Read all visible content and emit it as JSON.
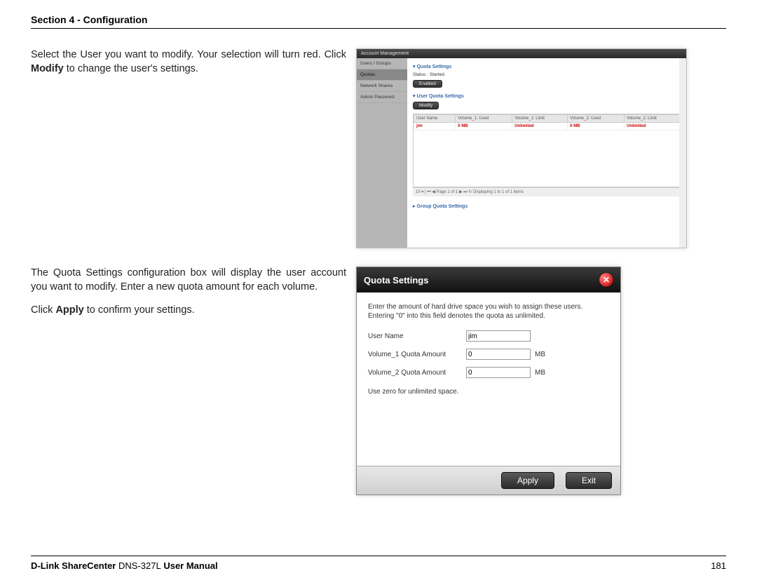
{
  "header": {
    "section": "Section 4 - Configuration"
  },
  "block1": {
    "p1a": "Select the User you want to modify. Your selection will turn red. Click ",
    "p1bold": "Modify",
    "p1b": " to change the user's settings."
  },
  "shot1": {
    "title": "Account Management",
    "sidebar": [
      "Users / Groups",
      "Quotas",
      "Network Shares",
      "Admin Password"
    ],
    "panel_quota": "Quota Settings",
    "status_label": "Status :",
    "status_value": "Started",
    "btn_enabled": "Enabled",
    "panel_user_quota": "User Quota Settings",
    "btn_modify": "Modify",
    "cols": [
      "User Name",
      "Volume_1: Used",
      "Volume_1: Limit",
      "Volume_2: Used",
      "Volume_2: Limit"
    ],
    "row": {
      "user": "jim",
      "v1u": "0 MB",
      "v1l": "Unlimited",
      "v2u": "0 MB",
      "v2l": "Unlimited"
    },
    "pager": "10 ▾ | ⏮ ◀  Page 1   of 1  ▶ ⏭  ↻   Displaying 1 to 1 of 1 items",
    "panel_group_quota": "Group Quota Settings"
  },
  "block2": {
    "p1": "The Quota Settings configuration box will display the user account you want to modify. Enter a new quota amount for each volume.",
    "p2a": "Click ",
    "p2bold": "Apply",
    "p2b": " to confirm your settings."
  },
  "shot2": {
    "title": "Quota Settings",
    "desc": "Enter the amount of hard drive space you wish to assign these users. Entering \"0\" into this field denotes the quota as unlimited.",
    "f_user_label": "User Name",
    "f_user_value": "jim",
    "f_v1_label": "Volume_1 Quota Amount",
    "f_v1_value": "0",
    "f_v2_label": "Volume_2 Quota Amount",
    "f_v2_value": "0",
    "unit": "MB",
    "note": "Use zero for unlimited space.",
    "btn_apply": "Apply",
    "btn_exit": "Exit"
  },
  "footer": {
    "brand": "D-Link ShareCenter",
    "model": "DNS-327L",
    "suffix": "User Manual",
    "page": "181"
  }
}
